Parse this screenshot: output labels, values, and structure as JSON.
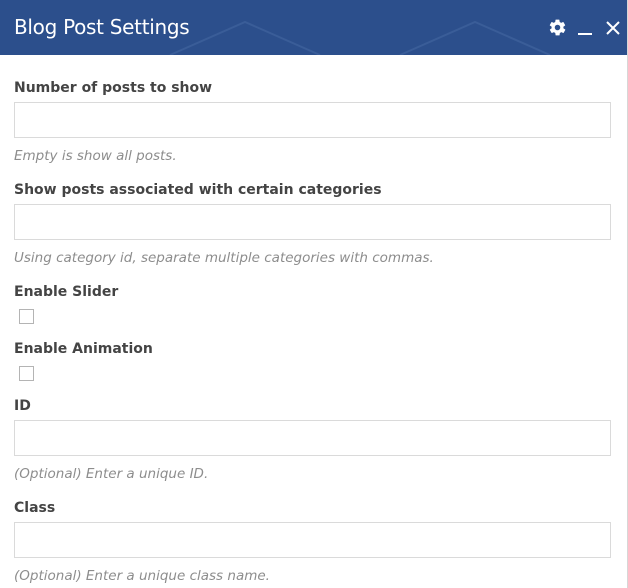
{
  "window": {
    "title": "Blog Post Settings"
  },
  "fields": {
    "num_posts": {
      "label": "Number of posts to show",
      "value": "",
      "help": "Empty is show all posts."
    },
    "categories": {
      "label": "Show posts associated with certain categories",
      "value": "",
      "help": "Using category id, separate multiple categories with commas."
    },
    "enable_slider": {
      "label": "Enable Slider",
      "checked": false
    },
    "enable_animation": {
      "label": "Enable Animation",
      "checked": false
    },
    "id": {
      "label": "ID",
      "value": "",
      "help": "(Optional) Enter a unique ID."
    },
    "class": {
      "label": "Class",
      "value": "",
      "help": "(Optional) Enter a unique class name."
    }
  },
  "icons": {
    "settings": "gear-icon",
    "minimize": "minimize-icon",
    "close": "close-icon"
  },
  "colors": {
    "header_bg": "#2c4f8c",
    "label_text": "#444444",
    "help_text": "#8d8d8d",
    "input_border": "#dadada"
  }
}
